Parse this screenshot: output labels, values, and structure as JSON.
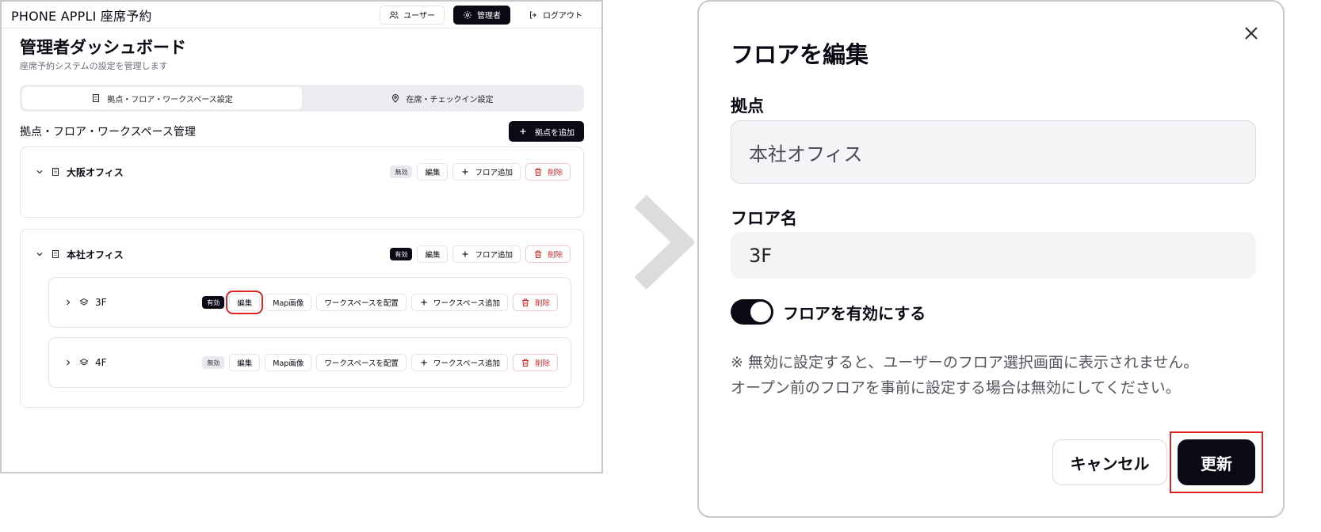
{
  "app": {
    "title": "PHONE APPLI 座席予約"
  },
  "topnav": {
    "user": "ユーザー",
    "admin": "管理者",
    "logout": "ログアウト"
  },
  "dashboard": {
    "title": "管理者ダッシュボード",
    "subtitle": "座席予約システムの設定を管理します"
  },
  "tabs": [
    {
      "label": "拠点・フロア・ワークスペース設定",
      "active": true
    },
    {
      "label": "在席・チェックイン設定",
      "active": false
    }
  ],
  "section": {
    "title": "拠点・フロア・ワークスペース管理",
    "add_site": "拠点を追加"
  },
  "sites": [
    {
      "name": "大阪オフィス",
      "status": "無効",
      "edit": "編集",
      "add_floor": "フロア追加",
      "delete": "削除"
    },
    {
      "name": "本社オフィス",
      "status": "有効",
      "edit": "編集",
      "add_floor": "フロア追加",
      "delete": "削除"
    }
  ],
  "floors": [
    {
      "name": "3F",
      "status": "有効",
      "edit": "編集",
      "map": "Map画像",
      "place": "ワークスペースを配置",
      "add_ws": "ワークスペース追加",
      "delete": "削除"
    },
    {
      "name": "4F",
      "status": "無効",
      "edit": "編集",
      "map": "Map画像",
      "place": "ワークスペースを配置",
      "add_ws": "ワークスペース追加",
      "delete": "削除"
    }
  ],
  "dialog": {
    "title": "フロアを編集",
    "site_label": "拠点",
    "site_value": "本社オフィス",
    "floor_label": "フロア名",
    "floor_value": "3F",
    "toggle_label": "フロアを有効にする",
    "toggle_on": true,
    "note_line1": "※ 無効に設定すると、ユーザーのフロア選択画面に表示されません。",
    "note_line2": "オープン前のフロアを事前に設定する場合は無効にしてください。",
    "cancel": "キャンセル",
    "update": "更新"
  },
  "colors": {
    "primary": "#0a0a14",
    "danger": "#dc2626",
    "highlight": "#e02424",
    "arrow": "#dcdcdc"
  }
}
